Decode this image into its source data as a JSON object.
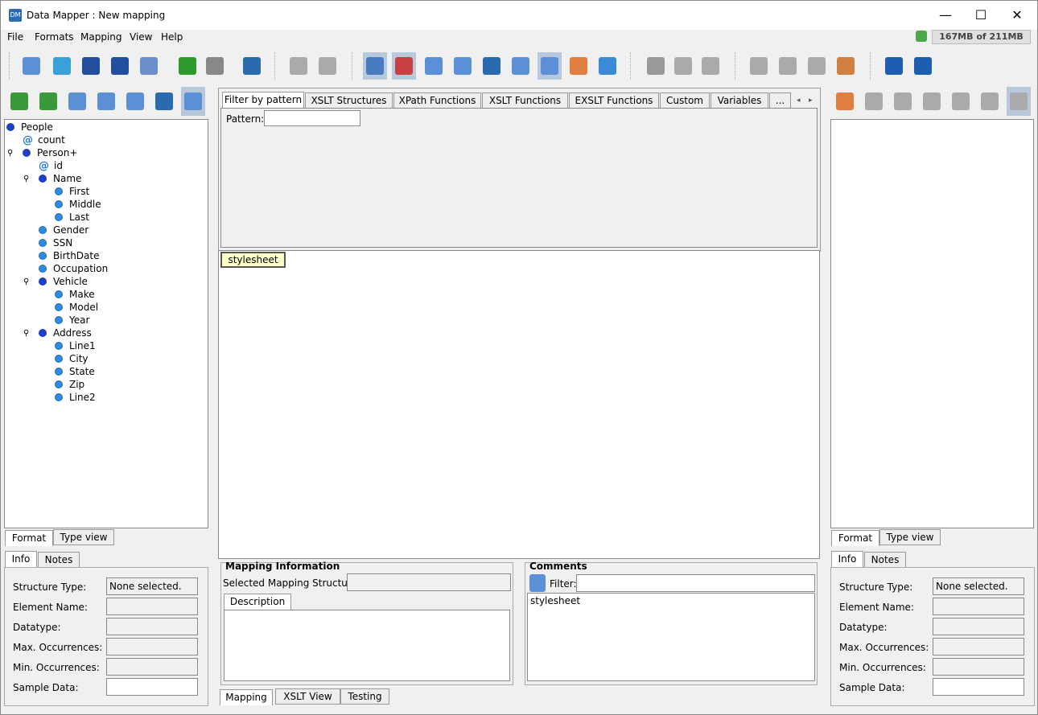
{
  "window": {
    "title": "Data Mapper : New mapping",
    "app_icon": "data-mapper-app-icon"
  },
  "window_controls": {
    "minimize": "—",
    "maximize": "☐",
    "close": "✕"
  },
  "menu": [
    "File",
    "Formats",
    "Mapping",
    "View",
    "Help"
  ],
  "memory": {
    "label": "167MB of 211MB",
    "icon": "garbage-collect-icon"
  },
  "toolbar": {
    "buttons": [
      {
        "name": "new-mapping-icon",
        "color": "#5b8fd6",
        "selected": false
      },
      {
        "name": "open-mapping-icon",
        "color": "#3aa0d8",
        "selected": false
      },
      {
        "name": "save-icon",
        "color": "#1f4f9e",
        "selected": false
      },
      {
        "name": "save-as-icon",
        "color": "#1f4f9e",
        "selected": false
      },
      {
        "name": "export-xls-icon",
        "color": "#6b8fc8",
        "selected": false
      },
      {
        "name": "undo-icon",
        "color": "#2e9a2e",
        "selected": false
      },
      {
        "name": "redo-icon",
        "color": "#888888",
        "selected": false
      },
      {
        "name": "exit-icon",
        "color": "#2a6ab0",
        "selected": false
      },
      {
        "name": "db-disabled-1-icon",
        "color": "#aaaaaa",
        "selected": false
      },
      {
        "name": "db-disabled-2-icon",
        "color": "#aaaaaa",
        "selected": false
      },
      {
        "name": "info-view-icon",
        "color": "#4a7ac0",
        "selected": true
      },
      {
        "name": "color-view-icon",
        "color": "#c84040",
        "selected": true
      },
      {
        "name": "xslt-list-icon",
        "color": "#5b8fd6",
        "selected": false
      },
      {
        "name": "xml-code-icon",
        "color": "#5b8fd6",
        "selected": false
      },
      {
        "name": "save-config-icon",
        "color": "#2a6ab0",
        "selected": false
      },
      {
        "name": "document-icon",
        "color": "#5b8fd6",
        "selected": false
      },
      {
        "name": "at-view-icon",
        "color": "#5b8fd6",
        "selected": true
      },
      {
        "name": "table-icon",
        "color": "#e08040",
        "selected": false
      },
      {
        "name": "database-icon",
        "color": "#3a8ad8",
        "selected": false
      },
      {
        "name": "cut-icon",
        "color": "#999999",
        "selected": false
      },
      {
        "name": "copy-icon",
        "color": "#aaaaaa",
        "selected": false
      },
      {
        "name": "paste-icon",
        "color": "#aaaaaa",
        "selected": false
      },
      {
        "name": "align-left-icon",
        "color": "#aaaaaa",
        "selected": false
      },
      {
        "name": "align-center-icon",
        "color": "#aaaaaa",
        "selected": false
      },
      {
        "name": "align-right-icon",
        "color": "#aaaaaa",
        "selected": false
      },
      {
        "name": "color-stack-icon",
        "color": "#d08040",
        "selected": false
      },
      {
        "name": "help-icon",
        "color": "#1e5eb0",
        "selected": false
      },
      {
        "name": "about-icon",
        "color": "#1e5eb0",
        "selected": false
      }
    ]
  },
  "left_toolbar": [
    {
      "name": "import-format-icon",
      "color": "#3a9a3a"
    },
    {
      "name": "find-icon",
      "color": "#3a9a3a"
    },
    {
      "name": "format-doc-icon",
      "color": "#5b8fd6"
    },
    {
      "name": "structure-list-icon",
      "color": "#5b8fd6"
    },
    {
      "name": "inspect-icon",
      "color": "#5b8fd6"
    },
    {
      "name": "edit-icon",
      "color": "#2a6ab0"
    },
    {
      "name": "tree-select-icon",
      "color": "#5b8fd6"
    }
  ],
  "right_toolbar": [
    {
      "name": "export-format-icon",
      "color": "#e08040"
    },
    {
      "name": "find-disabled-icon",
      "color": "#aaaaaa"
    },
    {
      "name": "format-doc-disabled-icon",
      "color": "#aaaaaa"
    },
    {
      "name": "structure-list-disabled-icon",
      "color": "#aaaaaa"
    },
    {
      "name": "inspect-disabled-icon",
      "color": "#aaaaaa"
    },
    {
      "name": "edit-disabled-icon",
      "color": "#aaaaaa"
    },
    {
      "name": "tree-select-disabled-icon",
      "color": "#aaaaaa"
    }
  ],
  "source_tree": [
    {
      "label": "People",
      "kind": "dark",
      "level": 0
    },
    {
      "label": "count",
      "kind": "attr",
      "level": 1
    },
    {
      "label": "Person+",
      "kind": "dark",
      "level": 1,
      "expander": true
    },
    {
      "label": "id",
      "kind": "attr",
      "level": 2
    },
    {
      "label": "Name",
      "kind": "dark",
      "level": 2,
      "expander": true
    },
    {
      "label": "First",
      "kind": "light",
      "level": 3
    },
    {
      "label": "Middle",
      "kind": "light",
      "level": 3
    },
    {
      "label": "Last",
      "kind": "light",
      "level": 3
    },
    {
      "label": "Gender",
      "kind": "light",
      "level": 2
    },
    {
      "label": "SSN",
      "kind": "light",
      "level": 2
    },
    {
      "label": "BirthDate",
      "kind": "light",
      "level": 2
    },
    {
      "label": "Occupation",
      "kind": "light",
      "level": 2
    },
    {
      "label": "Vehicle",
      "kind": "dark",
      "level": 2,
      "expander": true
    },
    {
      "label": "Make",
      "kind": "light",
      "level": 3
    },
    {
      "label": "Model",
      "kind": "light",
      "level": 3
    },
    {
      "label": "Year",
      "kind": "light",
      "level": 3
    },
    {
      "label": "Address",
      "kind": "dark",
      "level": 2,
      "expander": true
    },
    {
      "label": "Line1",
      "kind": "light",
      "level": 3
    },
    {
      "label": "City",
      "kind": "light",
      "level": 3
    },
    {
      "label": "State",
      "kind": "light",
      "level": 3
    },
    {
      "label": "Zip",
      "kind": "light",
      "level": 3
    },
    {
      "label": "Line2",
      "kind": "light",
      "level": 3
    }
  ],
  "left_tabs": {
    "format": "Format",
    "type_view": "Type view"
  },
  "right_tabs": {
    "format": "Format",
    "type_view": "Type view"
  },
  "info_tabs": {
    "info": "Info",
    "notes": "Notes"
  },
  "info_fields": {
    "structure_type": "Structure Type:",
    "element_name": "Element Name:",
    "datatype": "Datatype:",
    "max_occ": "Max. Occurrences:",
    "min_occ": "Min. Occurrences:",
    "sample_data": "Sample Data:",
    "structure_type_value": "None selected."
  },
  "function_tabs": [
    "Filter by pattern",
    "XSLT Structures",
    "XPath Functions",
    "XSLT Functions",
    "EXSLT Functions",
    "Custom",
    "Variables",
    "..."
  ],
  "pattern": {
    "label": "Pattern:",
    "value": ""
  },
  "canvas": {
    "node": "stylesheet"
  },
  "mapping_info": {
    "title": "Mapping Information",
    "selected_label": "Selected Mapping Structure:",
    "description_tab": "Description"
  },
  "comments": {
    "title": "Comments",
    "filter_label": "Filter:",
    "items": [
      "stylesheet"
    ]
  },
  "bottom_tabs": [
    "Mapping",
    "XSLT View",
    "Testing"
  ]
}
